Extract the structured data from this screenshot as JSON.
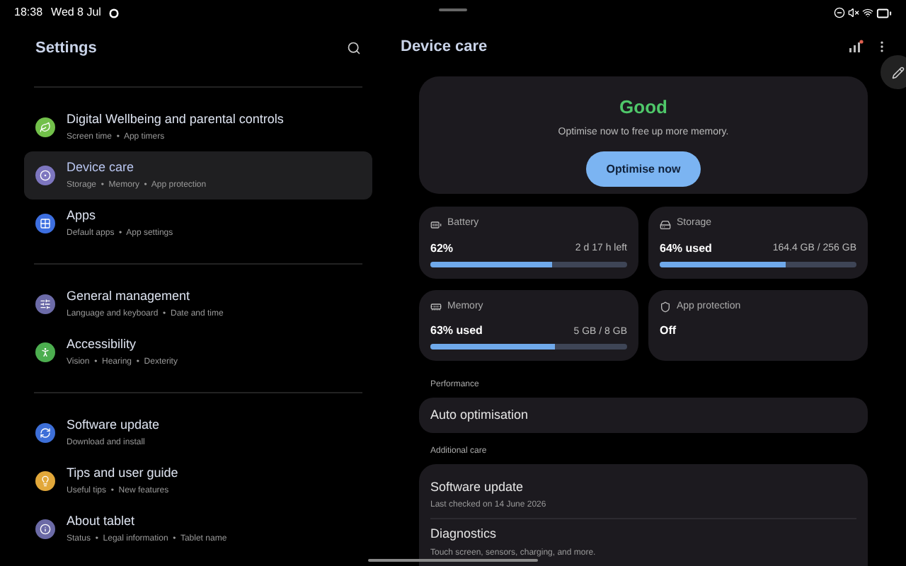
{
  "status_bar": {
    "time": "18:38",
    "date": "Wed 8 Jul"
  },
  "left_panel": {
    "title": "Settings",
    "groups": [
      [
        {
          "title": "Digital Wellbeing and parental controls",
          "subtitle": "Screen time  •  App timers",
          "color": "#72c04a",
          "selected": false
        },
        {
          "title": "Device care",
          "subtitle": "Storage  •  Memory  •  App protection",
          "color": "#7d76bf",
          "selected": true
        },
        {
          "title": "Apps",
          "subtitle": "Default apps  •  App settings",
          "color": "#3d6fe0",
          "selected": false
        }
      ],
      [
        {
          "title": "General management",
          "subtitle": "Language and keyboard  •  Date and time",
          "color": "#6c6ba8",
          "selected": false
        },
        {
          "title": "Accessibility",
          "subtitle": "Vision  •  Hearing  •  Dexterity",
          "color": "#4cae4f",
          "selected": false
        }
      ],
      [
        {
          "title": "Software update",
          "subtitle": "Download and install",
          "color": "#3d6fd8",
          "selected": false
        },
        {
          "title": "Tips and user guide",
          "subtitle": "Useful tips  •  New features",
          "color": "#e2a83a",
          "selected": false
        },
        {
          "title": "About tablet",
          "subtitle": "Status  •  Legal information  •  Tablet name",
          "color": "#6b6aa6",
          "selected": false
        }
      ]
    ]
  },
  "right_panel": {
    "title": "Device care",
    "status": {
      "heading": "Good",
      "message": "Optimise now to free up more memory.",
      "button": "Optimise now"
    },
    "tiles": [
      {
        "kind": "meter",
        "label": "Battery",
        "value": "62%",
        "detail": "2 d 17 h left",
        "level": 0.62
      },
      {
        "kind": "meter",
        "label": "Storage",
        "value": "64% used",
        "detail": "164.4 GB / 256 GB",
        "level": 0.64
      },
      {
        "kind": "meter",
        "label": "Memory",
        "value": "63% used",
        "detail": "5 GB / 8 GB",
        "level": 0.63
      },
      {
        "kind": "plain",
        "label": "App protection",
        "value": "Off"
      }
    ],
    "performance": {
      "heading": "Performance",
      "items": [
        {
          "title": "Auto optimisation"
        }
      ]
    },
    "additional_care": {
      "heading": "Additional care",
      "items": [
        {
          "title": "Software update",
          "subtitle": "Last checked on 14 June 2026"
        },
        {
          "title": "Diagnostics",
          "subtitle": "Touch screen, sensors, charging, and more."
        }
      ]
    }
  }
}
